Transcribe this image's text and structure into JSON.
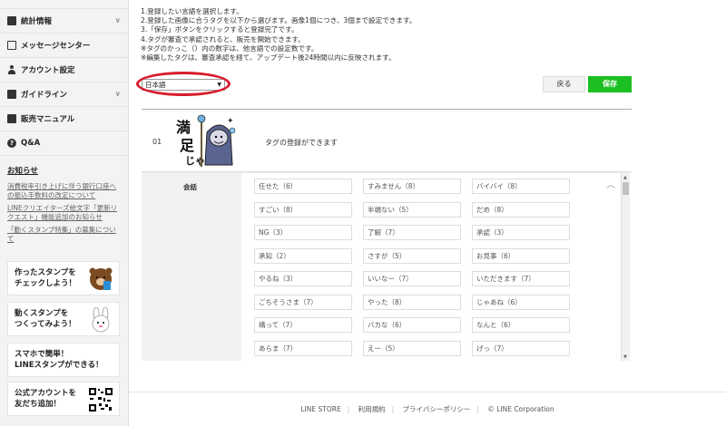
{
  "sidebar": {
    "items": [
      {
        "label": "統計情報",
        "icon": "chart-icon"
      },
      {
        "label": "メッセージセンター",
        "icon": "mail-icon"
      },
      {
        "label": "アカウント設定",
        "icon": "person-icon"
      },
      {
        "label": "ガイドライン",
        "icon": "book-icon"
      },
      {
        "label": "販売マニュアル",
        "icon": "book-icon"
      },
      {
        "label": "Q&A",
        "icon": "question-icon"
      }
    ],
    "notice_heading": "お知らせ",
    "notices": [
      "消費税率引き上げに伴う銀行口座への振込手数料の改定について",
      "LINEクリエイターズ絵文字「更新リクエスト」機能追加のお知らせ",
      "「動くスタンプ特集」の募集について"
    ],
    "promos": [
      {
        "line1": "作ったスタンプを",
        "line2": "チェックしよう！"
      },
      {
        "line1": "動くスタンプを",
        "line2": "つくってみよう！"
      },
      {
        "line1": "スマホで簡単！",
        "line2": "LINEスタンプができる！"
      },
      {
        "line1": "公式アカウントを",
        "line2": "友だち追加！"
      }
    ]
  },
  "instructions": [
    "1.登録したい言語を選択します。",
    "2.登録した画像に合うタグを以下から選びます。画像1個につき、3個まで設定できます。",
    "3.「保存」ボタンをクリックすると登録完了です。",
    "4.タグが審査で承認されると、販売を開始できます。",
    "※タグのかっこ（）内の数字は、他言語での設定数です。",
    "※編集したタグは、審査承認を経て、アップデート後24時間以内に反映されます。"
  ],
  "language_select": {
    "value": "日本語"
  },
  "buttons": {
    "back": "戻る",
    "save": "保存"
  },
  "sticker_row": {
    "number": "01",
    "status_text": "タグの登録ができます"
  },
  "tag_category": "会話",
  "tags": [
    [
      "任せた（6）",
      "すみません（8）",
      "バイバイ（8）"
    ],
    [
      "すごい（8）",
      "半端ない（5）",
      "だめ（8）"
    ],
    [
      "NG（3）",
      "了解（7）",
      "承認（3）"
    ],
    [
      "承知（2）",
      "さすが（5）",
      "お見事（6）"
    ],
    [
      "やるね（3）",
      "いいなー（7）",
      "いただきます（7）"
    ],
    [
      "ごちそうさま（7）",
      "やった（8）",
      "じゃあね（6）"
    ],
    [
      "構って（7）",
      "バカな（6）",
      "なんと（6）"
    ],
    [
      "あらま（7）",
      "えー（5）",
      "げっ（7）"
    ]
  ],
  "footer": {
    "links": [
      "LINE STORE",
      "利用規約",
      "プライバシーポリシー",
      "© LINE Corporation"
    ]
  }
}
